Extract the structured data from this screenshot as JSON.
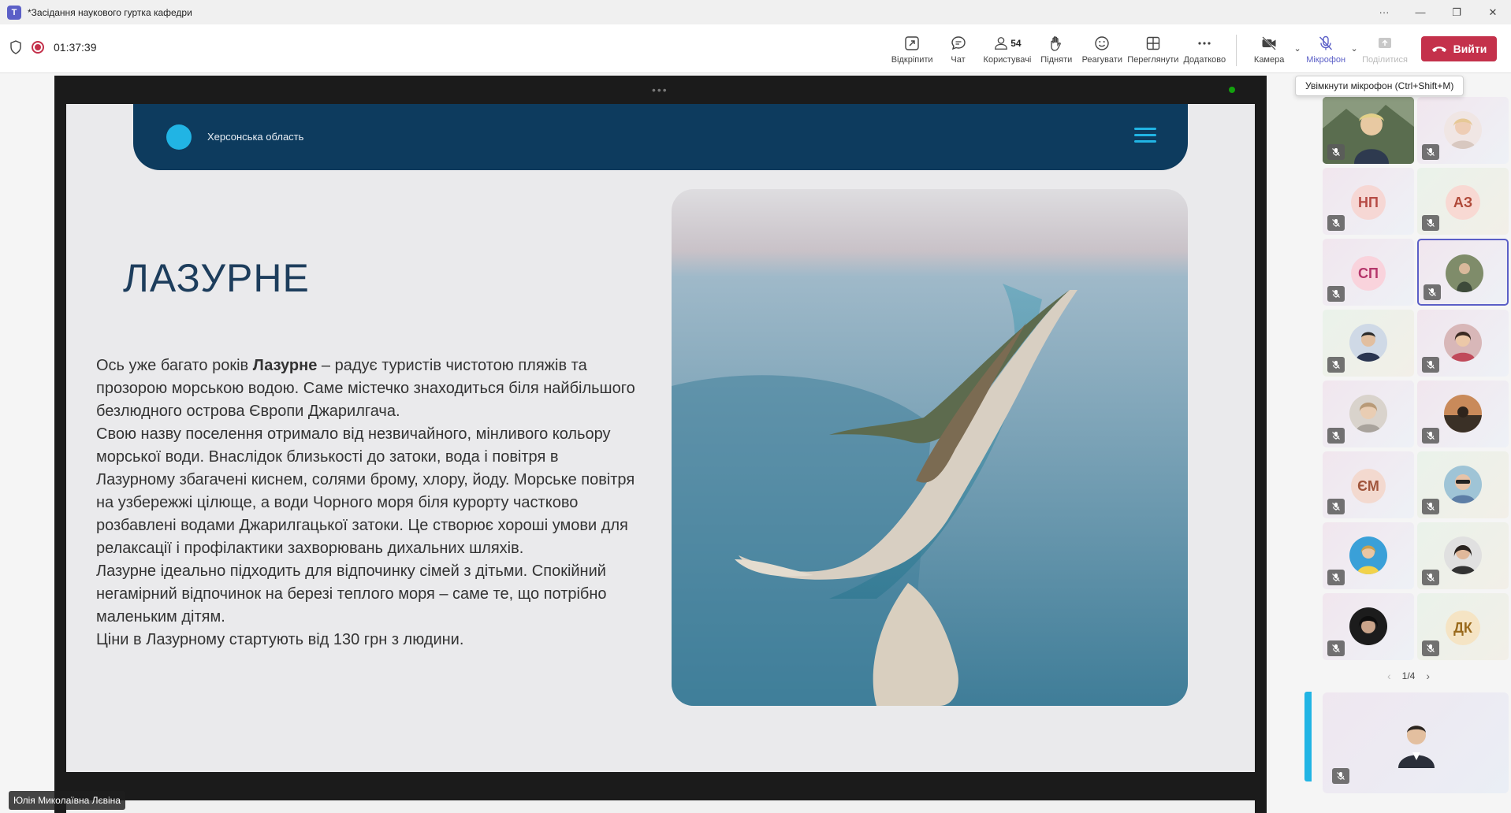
{
  "window": {
    "title": "*Засідання наукового гуртка кафедри",
    "logo_letter": "T",
    "controls": [
      "···",
      "—",
      "❐",
      "✕"
    ]
  },
  "meeting": {
    "timer": "01:37:39",
    "participants_count": "54"
  },
  "toolbar": {
    "unpin": "Відкріпити",
    "chat": "Чат",
    "users": "Користувачі",
    "raise": "Підняти",
    "react": "Реагувати",
    "view": "Переглянути",
    "more": "Додатково",
    "camera": "Камера",
    "mic": "Мікрофон",
    "share": "Поділитися",
    "leave": "Вийти"
  },
  "tooltip": "Увімкнути мікрофон (Ctrl+Shift+M)",
  "slide": {
    "region": "Херсонська область",
    "title": "ЛАЗУРНЕ",
    "p1_before": "Ось уже багато років ",
    "p1_bold": "Лазурне",
    "p1_after": " – радує туристів чистотою пляжів та прозорою морською водою. Саме містечко знаходиться біля найбільшого безлюдного острова Європи Джарилгача.",
    "p2": "Свою назву поселення отримало від незвичайного, мінливого кольору морської води. Внаслідок близькості до затоки, вода і повітря в Лазурному збагачені киснем, солями брому, хлору, йоду. Морське повітря на узбережжі цілюще, а води Чорного моря біля курорту частково розбавлені водами Джарилгацької затоки. Це створює хороші умови для релаксації і профілактики захворювань дихальних шляхів.",
    "p3": "Лазурне ідеально підходить для відпочинку сімей з дітьми. Спокійний негамірний відпочинок на березі теплого моря – саме те, що потрібно маленьким дітям.",
    "p4": "Ціни в Лазурному стартують від 130 грн з людини."
  },
  "speaker_name": "Юлія Миколаївна Лєвіна",
  "gallery": {
    "initials": [
      "НП",
      "АЗ",
      "СП",
      "ЄМ",
      "ДК"
    ],
    "page": "1/4",
    "prev": "‹",
    "next": "›"
  },
  "colors": {
    "brand": "#5b5fc7",
    "leave": "#c4314b",
    "slide_header": "#0d3b5e",
    "slide_accent": "#21b4e4"
  }
}
